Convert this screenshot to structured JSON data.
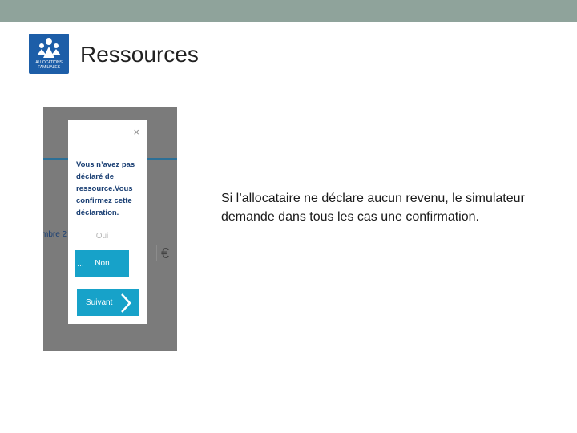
{
  "header": {
    "logo_text": "ALLOCATIONS FAMILIALES",
    "title": "Ressources"
  },
  "screenshot": {
    "background_month_text": "mbre 2",
    "currency_symbol": "€",
    "modal": {
      "close_glyph": "×",
      "question": "Vous n’avez pas déclaré de ressource.Vous confirmez cette déclaration.",
      "option_yes": "Oui",
      "option_no": "Non",
      "option_no_prefix": "…",
      "next_button": "Suivant"
    }
  },
  "caption": "Si l’allocataire ne déclare aucun revenu, le simulateur demande dans tous les cas une confirmation.",
  "colors": {
    "topbar": "#8fa39b",
    "logo_blue": "#1d5ea8",
    "accent_cyan": "#17a2c9",
    "modal_text": "#1a3f73"
  }
}
